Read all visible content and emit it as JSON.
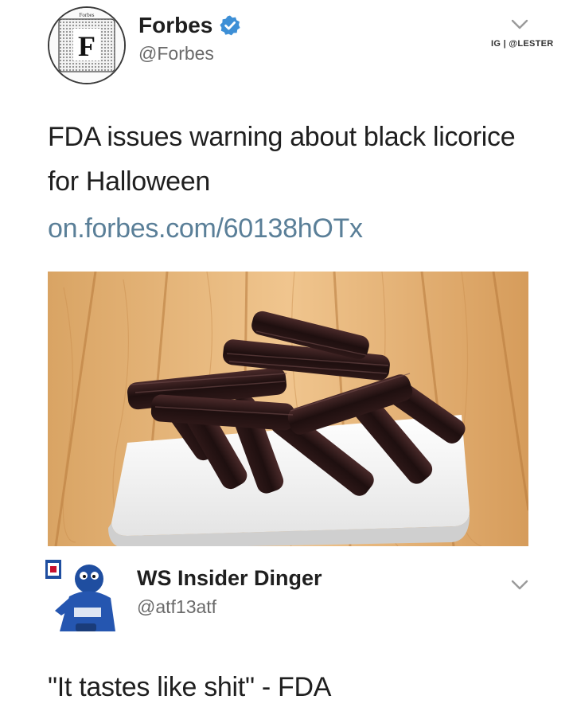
{
  "tweet": {
    "author_name": "Forbes",
    "author_handle": "@Forbes",
    "verified_icon": "verified-badge-icon",
    "avatar_label": "Forbes",
    "avatar_letter": "F",
    "watermark": "IG | @LESTER",
    "text": "FDA issues warning about black licorice for Halloween",
    "link": "on.forbes.com/60138hOTx",
    "link_color": "#5a7f98",
    "verified_color": "#3d8fd6",
    "image_alt": "Black licorice twists in a white square dish on a wooden table"
  },
  "reply": {
    "author_name": "WS Insider Dinger",
    "author_handle": "@atf13atf",
    "text": "\"It tastes like shit\" - FDA"
  }
}
